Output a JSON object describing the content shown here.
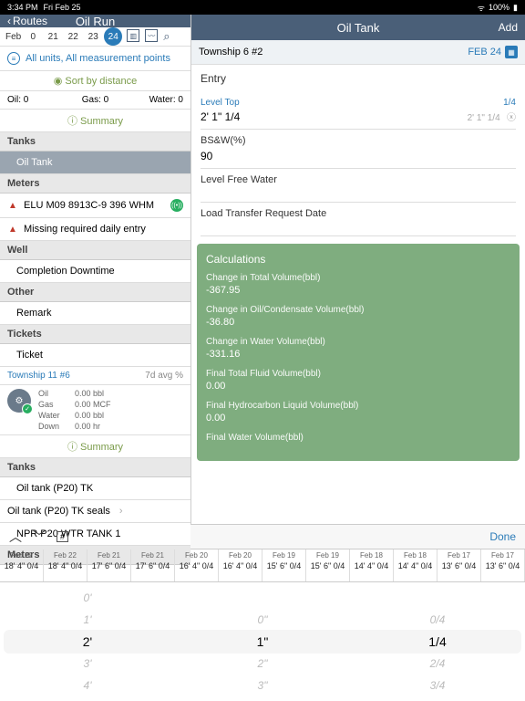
{
  "status_bar": {
    "time": "3:34 PM",
    "date": "Fri Feb 25",
    "wifi": "100%"
  },
  "left": {
    "back": "Routes",
    "title": "Oil Run",
    "month": "Feb",
    "dates": [
      "0",
      "21",
      "22",
      "23",
      "24"
    ],
    "active_date_index": 4,
    "filter_text": "All units, All measurement points",
    "sort_text": "Sort by distance",
    "stats": {
      "oil": "Oil: 0",
      "gas": "Gas: 0",
      "water": "Water: 0"
    },
    "summary": "Summary",
    "sections": {
      "tanks": "Tanks",
      "oil_tank": "Oil Tank",
      "meters": "Meters",
      "meter1": "ELU M09 8913C-9 396 WHM",
      "meter_missing": "Missing required daily entry",
      "well": "Well",
      "completion": "Completion Downtime",
      "other": "Other",
      "remark": "Remark",
      "tickets": "Tickets",
      "ticket": "Ticket"
    },
    "township": {
      "name": "Township 11 #6",
      "avg": "7d avg %",
      "rows": [
        {
          "label": "Oil",
          "value": "0.00 bbl"
        },
        {
          "label": "Gas",
          "value": "0.00 MCF"
        },
        {
          "label": "Water",
          "value": "0.00 bbl"
        },
        {
          "label": "Down",
          "value": "0.00 hr"
        }
      ],
      "summary": "Summary"
    },
    "tanks2": {
      "header": "Tanks",
      "tank1": "Oil tank (P20) TK",
      "seals": "Oil tank (P20) TK seals",
      "tank2": "NPR P20 WTR TANK 1",
      "meters": "Meters"
    }
  },
  "right": {
    "title": "Oil Tank",
    "add": "Add",
    "sub_name": "Township 6 #2",
    "sub_date": "FEB 24",
    "entry": "Entry",
    "fields": {
      "level_top": {
        "label": "Level Top",
        "fraction": "1/4",
        "value": "2' 1\" 1/4",
        "hint": "2' 1\" 1/4"
      },
      "bsw": {
        "label": "BS&W(%)",
        "value": "90"
      },
      "free_water": {
        "label": "Level Free Water"
      },
      "load_transfer": {
        "label": "Load Transfer Request Date"
      }
    },
    "calc": {
      "title": "Calculations",
      "rows": [
        {
          "label": "Change in Total Volume(bbl)",
          "value": "-367.95"
        },
        {
          "label": "Change in Oil/Condensate Volume(bbl)",
          "value": "-36.80"
        },
        {
          "label": "Change in Water Volume(bbl)",
          "value": "-331.16"
        },
        {
          "label": "Final Total Fluid Volume(bbl)",
          "value": "0.00"
        },
        {
          "label": "Final Hydrocarbon Liquid Volume(bbl)",
          "value": "0.00"
        },
        {
          "label": "Final Water Volume(bbl)",
          "value": ""
        }
      ]
    }
  },
  "picker": {
    "done": "Done",
    "history": [
      {
        "date": "Feb 22",
        "val": "18' 4\" 0/4"
      },
      {
        "date": "Feb 22",
        "val": "18' 4\" 0/4"
      },
      {
        "date": "Feb 21",
        "val": "17' 6\" 0/4"
      },
      {
        "date": "Feb 21",
        "val": "17' 6\" 0/4"
      },
      {
        "date": "Feb 20",
        "val": "16' 4\" 0/4"
      },
      {
        "date": "Feb 20",
        "val": "16' 4\" 0/4"
      },
      {
        "date": "Feb 19",
        "val": "15' 6\" 0/4"
      },
      {
        "date": "Feb 19",
        "val": "15' 6\" 0/4"
      },
      {
        "date": "Feb 18",
        "val": "14' 4\" 0/4"
      },
      {
        "date": "Feb 18",
        "val": "14' 4\" 0/4"
      },
      {
        "date": "Feb 17",
        "val": "13' 6\" 0/4"
      },
      {
        "date": "Feb 17",
        "val": "13' 6\" 0/4"
      }
    ],
    "cols": [
      {
        "items": [
          "0'",
          "1'",
          "2'",
          "3'",
          "4'"
        ],
        "selected": 2
      },
      {
        "items": [
          "",
          "0\"",
          "1\"",
          "2\"",
          "3\""
        ],
        "selected": 2
      },
      {
        "items": [
          "",
          "0/4",
          "1/4",
          "2/4",
          "3/4"
        ],
        "selected": 2
      }
    ]
  }
}
